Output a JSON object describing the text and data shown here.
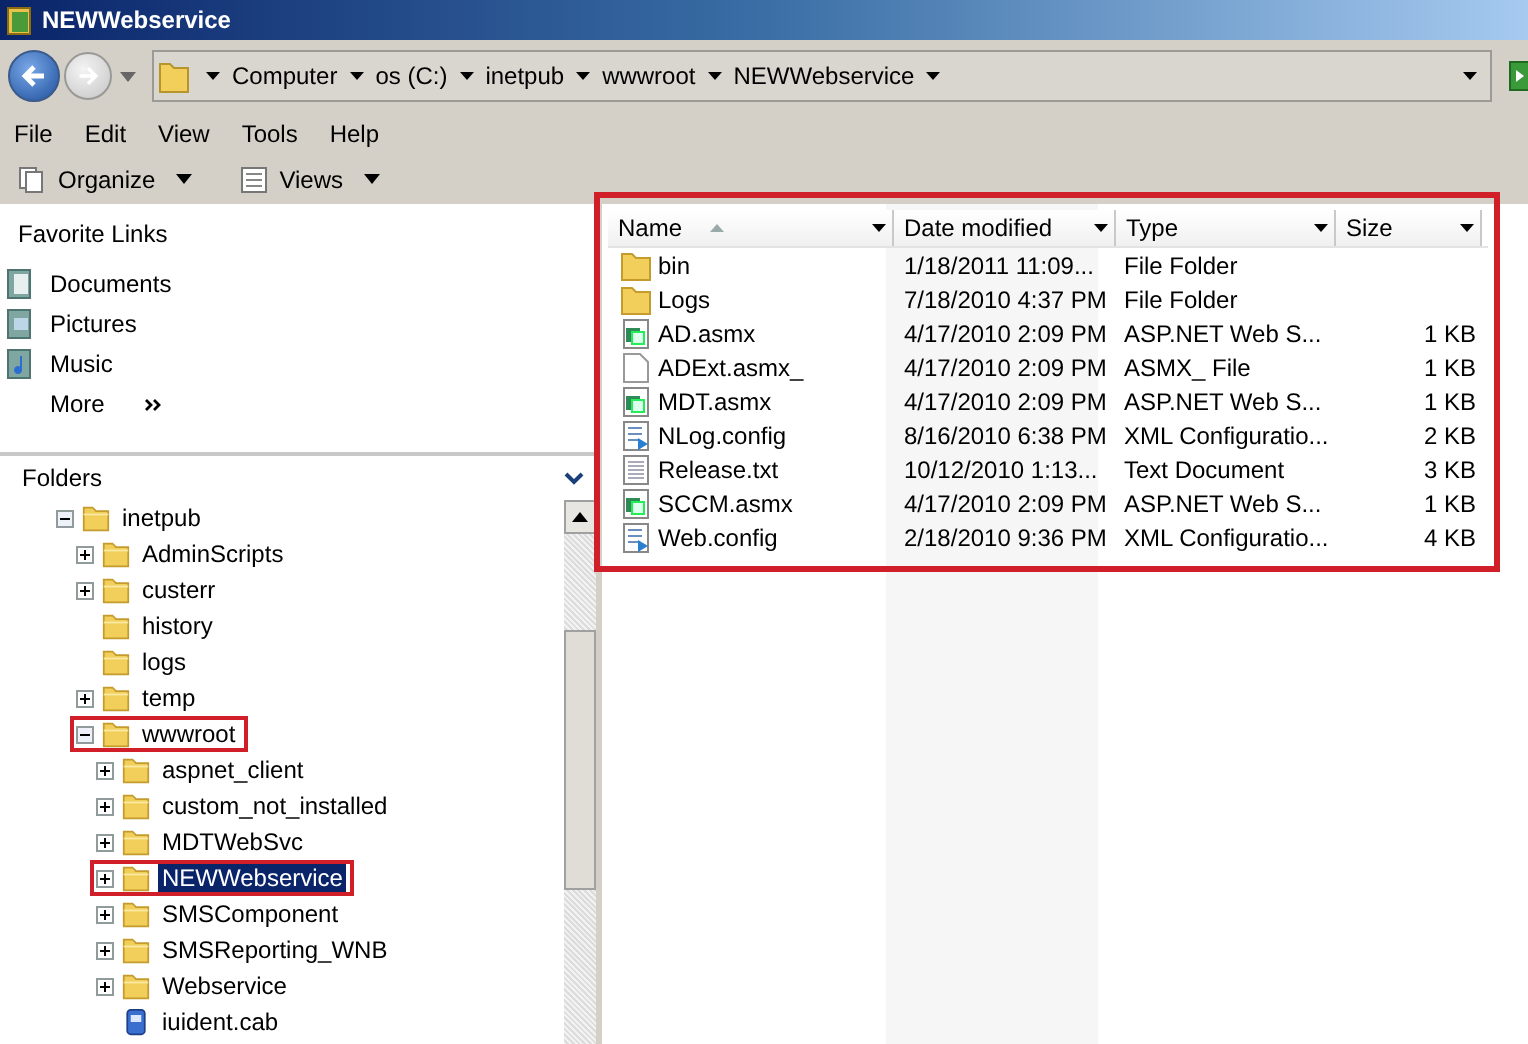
{
  "window": {
    "title": "NEWWebservice"
  },
  "address_bar": {
    "segments": [
      "Computer",
      "os (C:)",
      "inetpub",
      "wwwroot",
      "NEWWebservice"
    ]
  },
  "menu": [
    "File",
    "Edit",
    "View",
    "Tools",
    "Help"
  ],
  "toolbar": [
    "Organize",
    "Views"
  ],
  "favorite_links": {
    "title": "Favorite Links",
    "items": [
      {
        "label": "Documents",
        "kind": "documents"
      },
      {
        "label": "Pictures",
        "kind": "pictures"
      },
      {
        "label": "Music",
        "kind": "music"
      },
      {
        "label": "More",
        "kind": "more"
      }
    ]
  },
  "folders": {
    "title": "Folders",
    "tree": [
      {
        "name": "inetpub",
        "kind": "folder",
        "expandable": true,
        "expanded": true,
        "selected": false,
        "highlighted": false,
        "children": [
          {
            "name": "AdminScripts",
            "kind": "folder",
            "expandable": true,
            "expanded": false,
            "selected": false,
            "highlighted": false
          },
          {
            "name": "custerr",
            "kind": "folder",
            "expandable": true,
            "expanded": false,
            "selected": false,
            "highlighted": false
          },
          {
            "name": "history",
            "kind": "folder",
            "expandable": false,
            "expanded": false,
            "selected": false,
            "highlighted": false
          },
          {
            "name": "logs",
            "kind": "folder",
            "expandable": false,
            "expanded": false,
            "selected": false,
            "highlighted": false
          },
          {
            "name": "temp",
            "kind": "folder",
            "expandable": true,
            "expanded": false,
            "selected": false,
            "highlighted": false
          },
          {
            "name": "wwwroot",
            "kind": "folder",
            "expandable": true,
            "expanded": true,
            "selected": false,
            "highlighted": true,
            "children": [
              {
                "name": "aspnet_client",
                "kind": "folder",
                "expandable": true,
                "expanded": false,
                "selected": false,
                "highlighted": false
              },
              {
                "name": "custom_not_installed",
                "kind": "folder",
                "expandable": true,
                "expanded": false,
                "selected": false,
                "highlighted": false
              },
              {
                "name": "MDTWebSvc",
                "kind": "folder",
                "expandable": true,
                "expanded": false,
                "selected": false,
                "highlighted": false
              },
              {
                "name": "NEWWebservice",
                "kind": "folder",
                "expandable": true,
                "expanded": false,
                "selected": true,
                "highlighted": true
              },
              {
                "name": "SMSComponent",
                "kind": "folder",
                "expandable": true,
                "expanded": false,
                "selected": false,
                "highlighted": false
              },
              {
                "name": "SMSReporting_WNB",
                "kind": "folder",
                "expandable": true,
                "expanded": false,
                "selected": false,
                "highlighted": false
              },
              {
                "name": "Webservice",
                "kind": "folder",
                "expandable": true,
                "expanded": false,
                "selected": false,
                "highlighted": false
              },
              {
                "name": "iuident.cab",
                "kind": "cab",
                "expandable": false,
                "expanded": false,
                "selected": false,
                "highlighted": false
              }
            ]
          }
        ]
      }
    ]
  },
  "file_list": {
    "highlighted": true,
    "columns": [
      {
        "label": "Name",
        "sorted": true
      },
      {
        "label": "Date modified",
        "sorted": false
      },
      {
        "label": "Type",
        "sorted": false
      },
      {
        "label": "Size",
        "sorted": false
      }
    ],
    "rows": [
      {
        "name": "bin",
        "kind": "folder",
        "date": "1/18/2011 11:09...",
        "type": "File Folder"
      },
      {
        "name": "Logs",
        "kind": "folder",
        "date": "7/18/2010 4:37 PM",
        "type": "File Folder"
      },
      {
        "name": "AD.asmx",
        "kind": "asmx",
        "date": "4/17/2010 2:09 PM",
        "type": "ASP.NET Web S...",
        "size": "1 KB"
      },
      {
        "name": "ADExt.asmx_",
        "kind": "blank",
        "date": "4/17/2010 2:09 PM",
        "type": "ASMX_ File",
        "size": "1 KB"
      },
      {
        "name": "MDT.asmx",
        "kind": "asmx",
        "date": "4/17/2010 2:09 PM",
        "type": "ASP.NET Web S...",
        "size": "1 KB"
      },
      {
        "name": "NLog.config",
        "kind": "config",
        "date": "8/16/2010 6:38 PM",
        "type": "XML Configuratio...",
        "size": "2 KB"
      },
      {
        "name": "Release.txt",
        "kind": "text",
        "date": "10/12/2010 1:13...",
        "type": "Text Document",
        "size": "3 KB"
      },
      {
        "name": "SCCM.asmx",
        "kind": "asmx",
        "date": "4/17/2010 2:09 PM",
        "type": "ASP.NET Web S...",
        "size": "1 KB"
      },
      {
        "name": "Web.config",
        "kind": "config",
        "date": "2/18/2010 9:36 PM",
        "type": "XML Configuratio...",
        "size": "4 KB"
      }
    ]
  }
}
